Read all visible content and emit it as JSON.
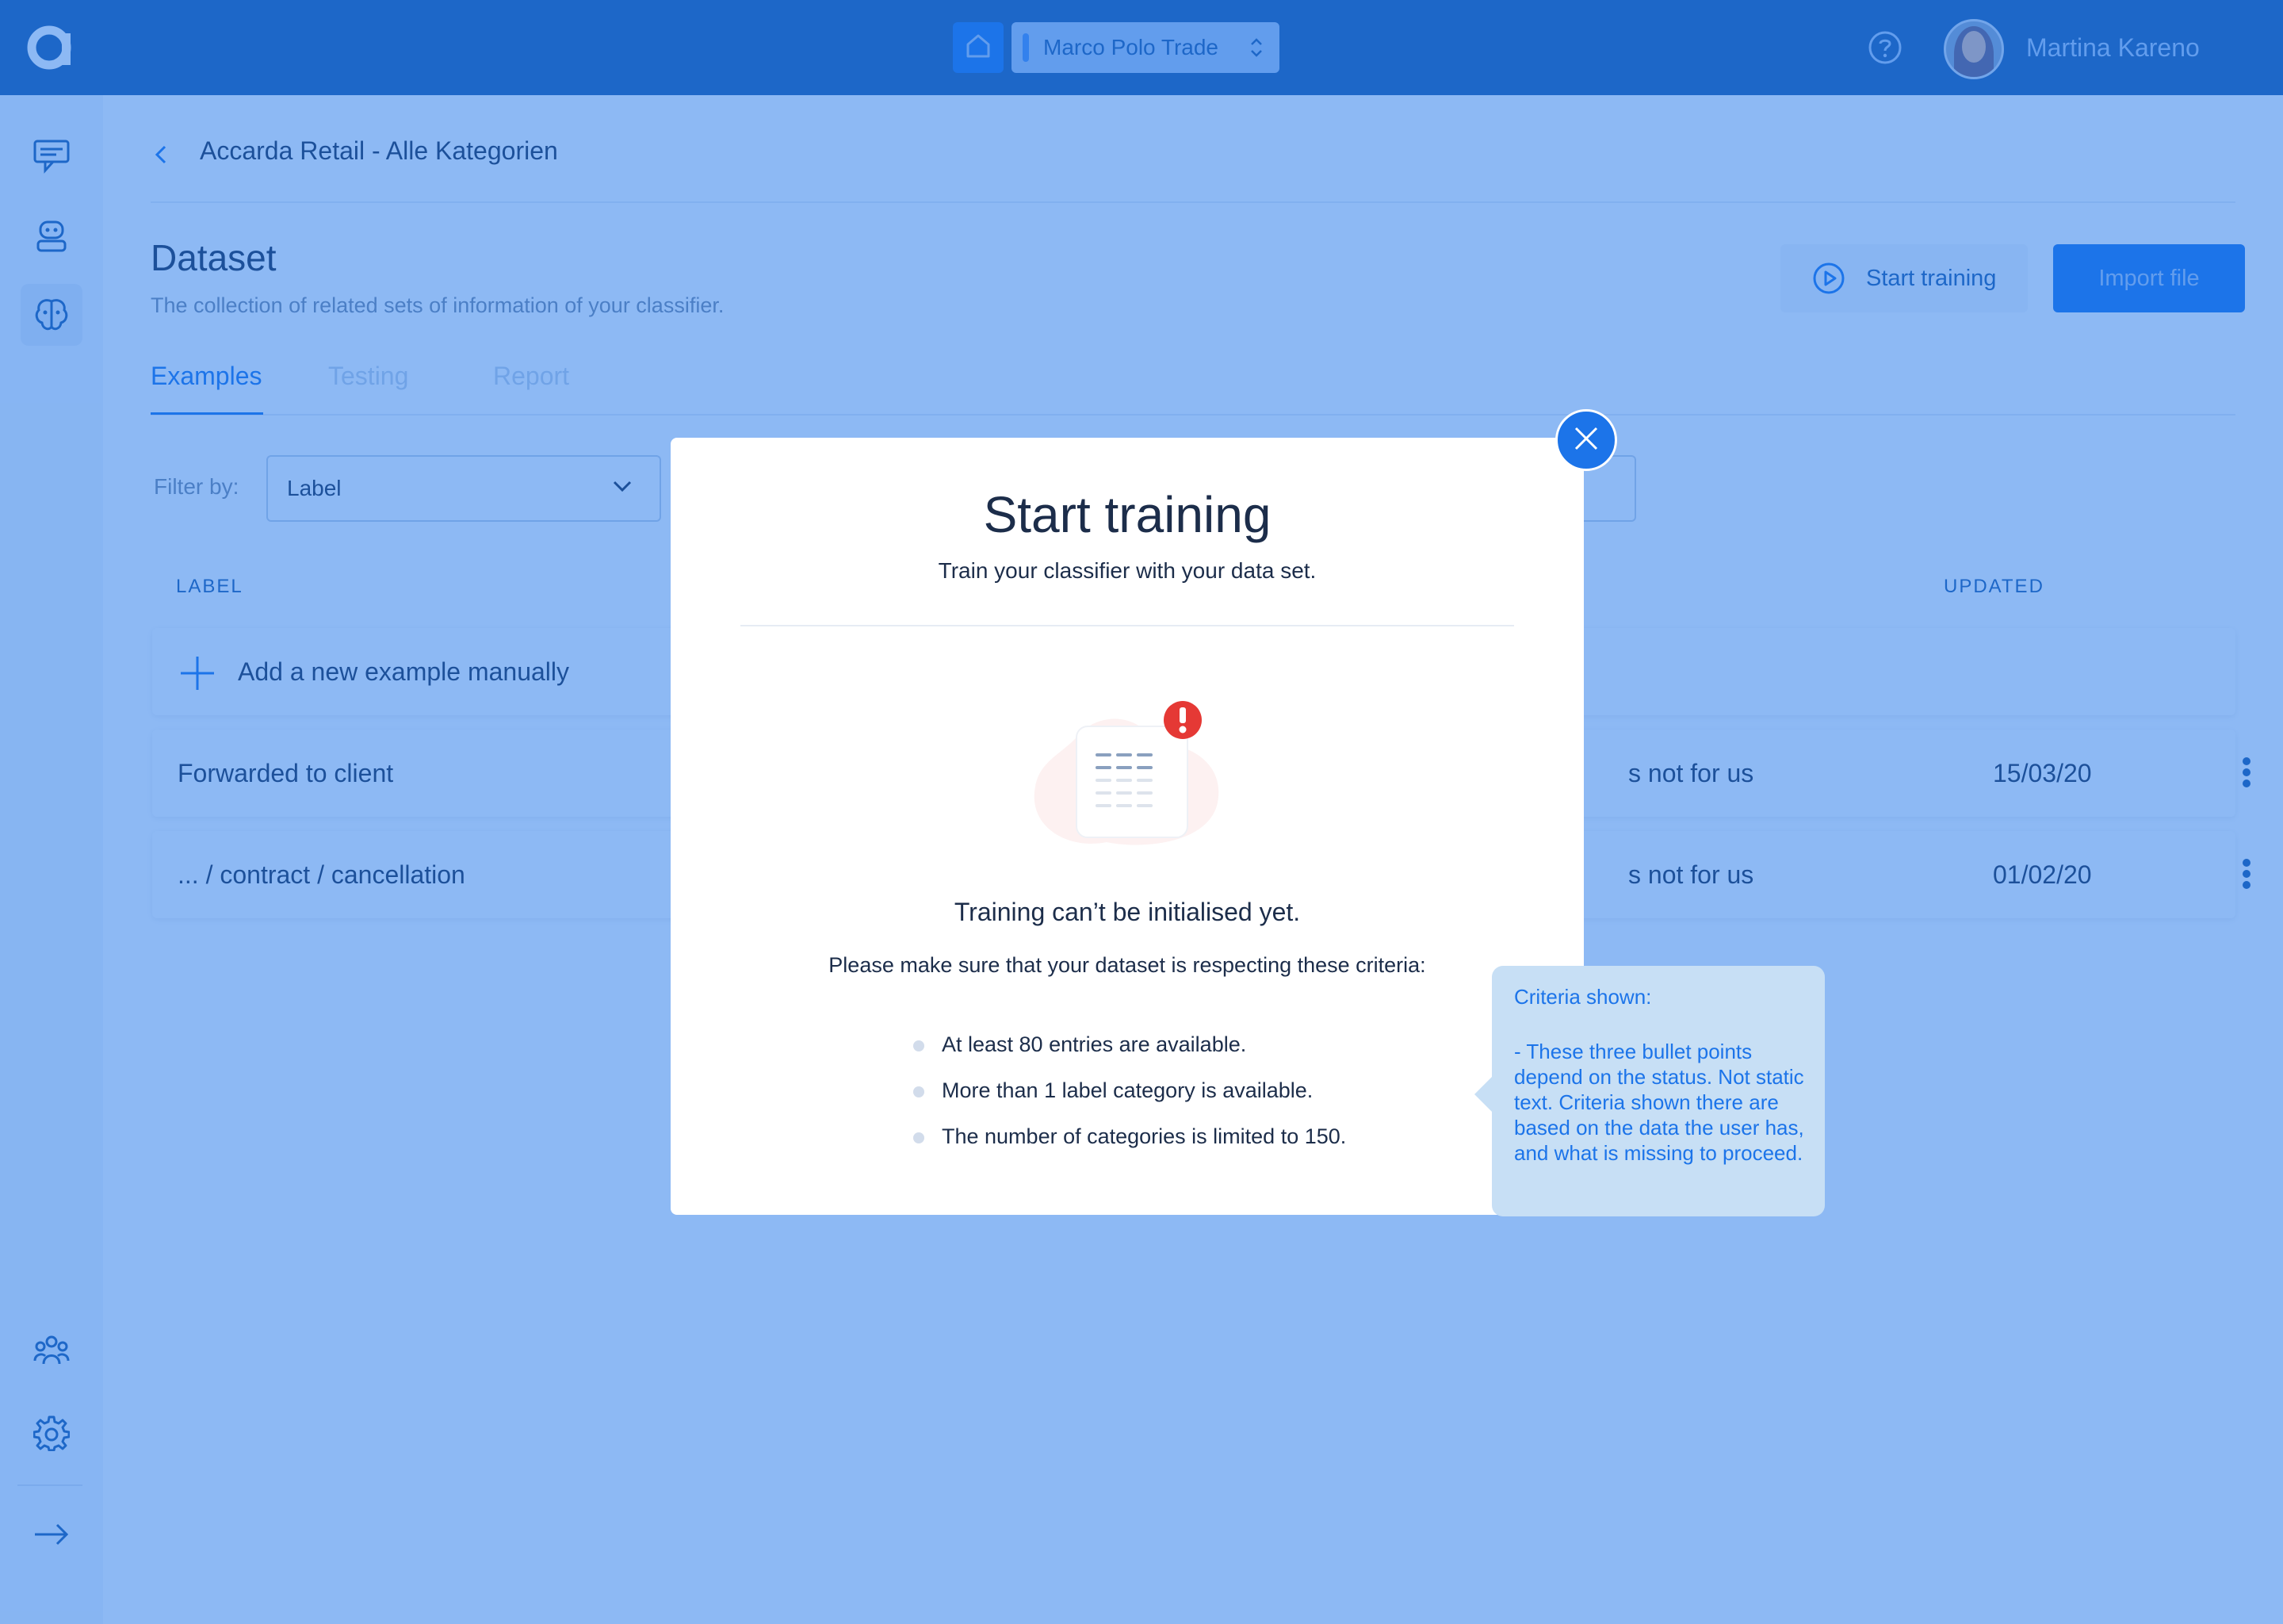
{
  "topbar": {
    "workspace": "Marco Polo Trade",
    "user_name": "Martina Kareno"
  },
  "icons": {
    "logo": "brand-logo-icon",
    "home": "home-icon",
    "switch": "chevron-updown-icon",
    "help": "help-circle-icon",
    "sidebar": [
      "chat-icon",
      "robot-icon",
      "brain-icon",
      "team-icon",
      "gear-icon",
      "arrow-right-icon"
    ]
  },
  "breadcrumb": {
    "label": "Accarda Retail - Alle Kategorien"
  },
  "page": {
    "title": "Dataset",
    "subtitle": "The collection of related sets of information of your classifier.",
    "start_training_label": "Start training",
    "import_label": "Import file"
  },
  "tabs": [
    "Examples",
    "Testing",
    "Report"
  ],
  "filter": {
    "label": "Filter by:",
    "value": "Label"
  },
  "table": {
    "headers": {
      "label": "LABEL",
      "updated": "UPDATED"
    },
    "add_row": "Add a new example manually",
    "rows": [
      {
        "label": "Forwarded to client",
        "status": "s not for us",
        "updated": "15/03/20"
      },
      {
        "label": "... / contract / cancellation",
        "status": "s not for us",
        "updated": "01/02/20"
      }
    ]
  },
  "modal": {
    "title": "Start training",
    "subtitle": "Train your classifier with your data set.",
    "message": "Training can’t be initialised yet.",
    "note": "Please make sure that your dataset is respecting these criteria:",
    "criteria": [
      "At least 80 entries are available.",
      "More than 1 label category is available.",
      "The number of categories is limited to 150."
    ]
  },
  "annotation": {
    "heading": "Criteria shown:",
    "body": "- These three bullet points depend on the status. Not static text. Criteria shown there are based on the data the user has, and what is missing to proceed."
  },
  "colors": {
    "primary": "#1c74e9",
    "topbar": "#1f5aa6",
    "text": "#1c2d4a",
    "alert": "#e53935"
  }
}
